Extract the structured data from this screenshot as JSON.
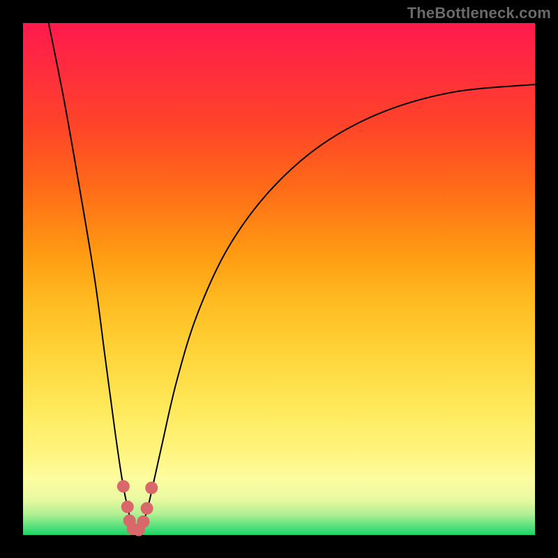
{
  "watermark": "TheBottleneck.com",
  "colors": {
    "frame": "#000000",
    "marker": "#d9686a",
    "curve": "#000000"
  },
  "chart_data": {
    "type": "line",
    "title": "",
    "xlabel": "",
    "ylabel": "",
    "xlim": [
      0,
      100
    ],
    "ylim": [
      0,
      100
    ],
    "grid": false,
    "legend": false,
    "note": "Abstract V-shaped bottleneck curve over gradient. No axis ticks/labels are rendered. x is horizontal position (0=left, 100=right), y is height above bottom (0=bottom, 100=top).",
    "series": [
      {
        "name": "bottleneck-curve",
        "x": [
          5,
          8,
          11,
          14,
          16,
          18,
          19.5,
          21,
          22,
          23,
          24,
          25,
          27,
          30,
          34,
          40,
          48,
          58,
          70,
          84,
          100
        ],
        "y": [
          100,
          85,
          68,
          50,
          35,
          20,
          10,
          3,
          0.5,
          1.5,
          4,
          8,
          17,
          30,
          43,
          56,
          67,
          76,
          82.5,
          86.5,
          88
        ]
      }
    ],
    "markers": [
      {
        "x": 19.6,
        "y": 9.5
      },
      {
        "x": 20.4,
        "y": 5.5
      },
      {
        "x": 20.8,
        "y": 2.8
      },
      {
        "x": 21.5,
        "y": 1.2
      },
      {
        "x": 22.6,
        "y": 1.0
      },
      {
        "x": 23.5,
        "y": 2.6
      },
      {
        "x": 24.2,
        "y": 5.2
      },
      {
        "x": 25.1,
        "y": 9.2
      }
    ]
  }
}
